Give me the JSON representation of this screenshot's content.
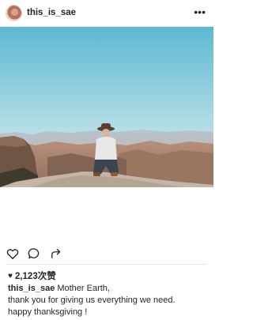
{
  "post": {
    "username": "this_is_sae",
    "more_icon": "more-horizontal-icon",
    "likes_text": "2,123次赞",
    "caption_user": "this_is_sae",
    "caption_line1": "Mother Earth,",
    "caption_line2": "thank you for giving us everything we need.",
    "caption_line3": "happy thanksgiving !"
  },
  "actions": {
    "like_icon": "heart-outline-icon",
    "comment_icon": "comment-bubble-icon",
    "share_icon": "share-arrow-icon"
  },
  "colors": {
    "sky_top": "#5fb9d2",
    "sky_bottom": "#d8ecef",
    "canyon": "#a9876f",
    "text": "#262626"
  }
}
